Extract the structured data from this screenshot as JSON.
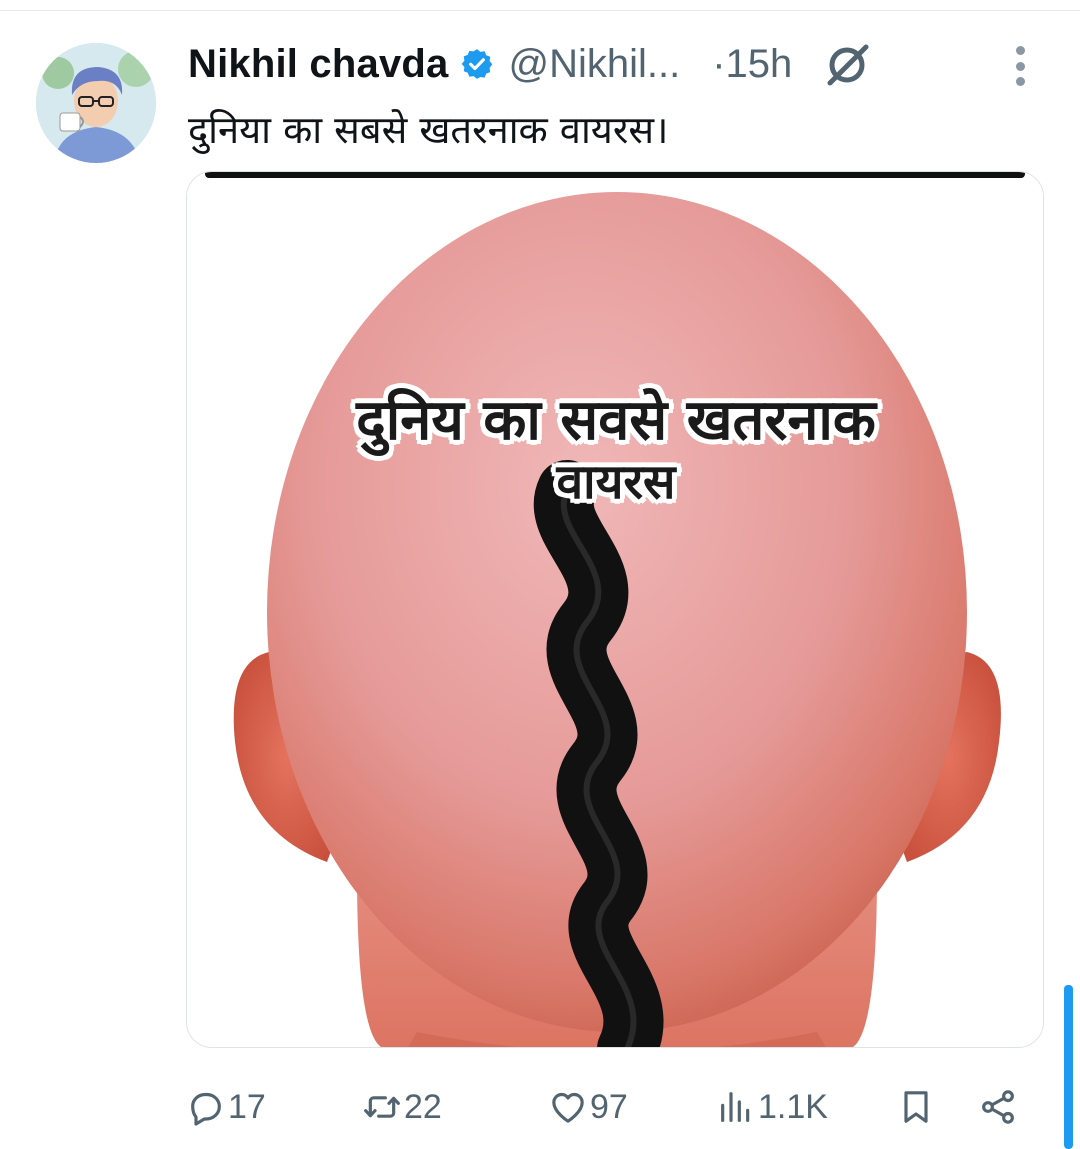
{
  "tweet": {
    "author": {
      "display_name": "Nikhil chavda",
      "handle": "@Nikhil...",
      "verified": true
    },
    "time": "·15h",
    "text": "दुनिया का सबसे खतरनाक वायरस।",
    "media": {
      "caption_line1": "दुनिय का सवसे खतरनाक",
      "caption_line2": "वायरस"
    },
    "actions": {
      "replies": "17",
      "reposts": "22",
      "likes": "97",
      "views": "1.1K"
    }
  },
  "icons": {
    "verified": "verified-badge-icon",
    "grok": "grok-icon",
    "more": "more-options-icon",
    "reply": "reply-icon",
    "repost": "repost-icon",
    "like": "heart-icon",
    "views": "views-chart-icon",
    "bookmark": "bookmark-icon",
    "share": "share-icon"
  },
  "colors": {
    "accent": "#1d9bf0",
    "text_primary": "#0f1419",
    "text_secondary": "#536471"
  }
}
